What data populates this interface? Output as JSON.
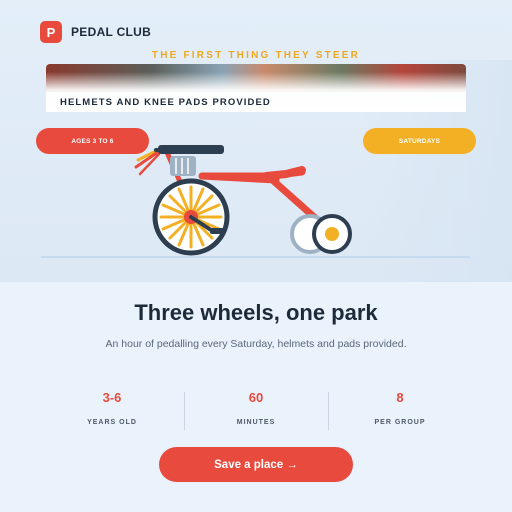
{
  "brand": {
    "logo_letter": "P",
    "name": "PEDAL CLUB"
  },
  "hero": {
    "eyebrow": "THE FIRST THING THEY STEER",
    "strip_caption": "HELMETS AND KNEE PADS PROVIDED",
    "age_pill": "AGES 3 TO 6",
    "day_pill": "SATURDAYS"
  },
  "main": {
    "headline": "Three wheels, one park",
    "subline": "An hour of pedalling every Saturday, helmets and pads provided."
  },
  "stats": [
    {
      "value": "3-6",
      "label": "YEARS OLD"
    },
    {
      "value": "60",
      "label": "MINUTES"
    },
    {
      "value": "8",
      "label": "PER GROUP"
    }
  ],
  "cta": {
    "label": "Save a place →"
  },
  "colors": {
    "primary": "#e84a3d",
    "accent": "#f3b025",
    "ink": "#1d2a3a",
    "background": "#eaf2fb"
  },
  "icons": {
    "illustration": "tricycle-illustration"
  }
}
